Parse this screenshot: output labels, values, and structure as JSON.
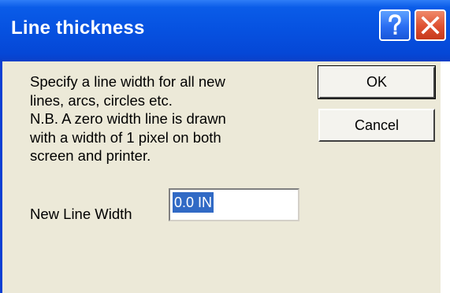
{
  "window": {
    "title": "Line thickness",
    "help_icon": "question-mark-icon",
    "close_icon": "close-x-icon"
  },
  "description": {
    "lines": [
      "Specify a line width for all new",
      "lines, arcs, circles etc.",
      "N.B. A zero width line is drawn",
      "with a width of 1 pixel on both",
      "screen and printer."
    ]
  },
  "buttons": {
    "ok": "OK",
    "cancel": "Cancel"
  },
  "field": {
    "label": "New Line Width",
    "value": "0.0 IN",
    "selected": true
  },
  "colors": {
    "titlebar": "#0651e0",
    "face": "#ece9d8",
    "selection": "#316ac5",
    "close": "#de5030"
  }
}
